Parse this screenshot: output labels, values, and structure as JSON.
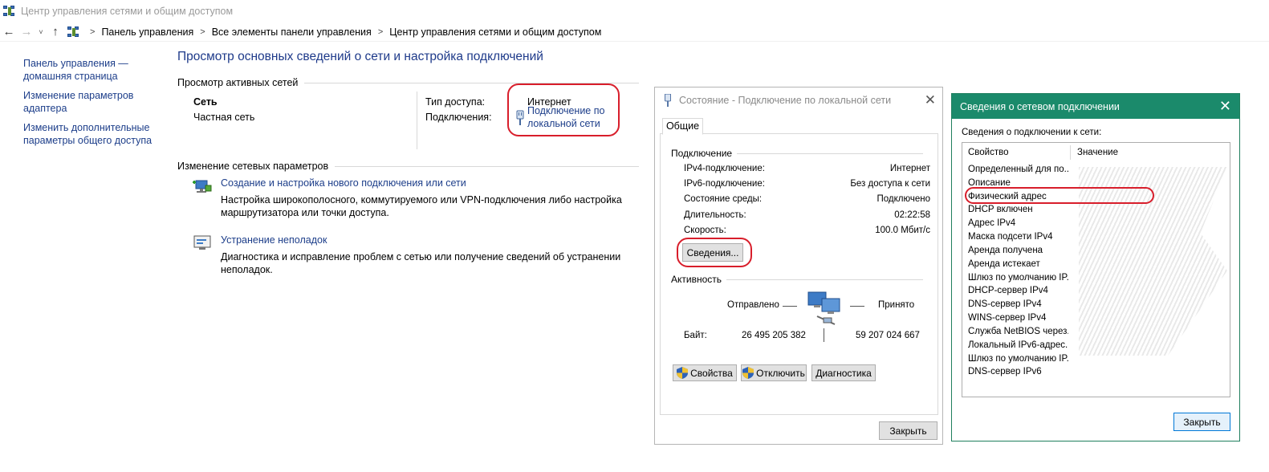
{
  "window": {
    "title": "Центр управления сетями и общим доступом"
  },
  "address_bar": {
    "breadcrumbs": [
      "Панель управления",
      "Все элементы панели управления",
      "Центр управления сетями и общим доступом"
    ]
  },
  "left_nav": {
    "items": [
      "Панель управления — домашняя страница",
      "Изменение параметров адаптера",
      "Изменить дополнительные параметры общего доступа"
    ]
  },
  "main": {
    "title": "Просмотр основных сведений о сети и настройка подключений",
    "active_networks_header": "Просмотр активных сетей",
    "network": {
      "name": "Сеть",
      "type": "Частная сеть",
      "access_type_label": "Тип доступа:",
      "access_type_value": "Интернет",
      "connections_label": "Подключения:",
      "connection_link_line1": "Подключение по",
      "connection_link_line2": "локальной сети"
    },
    "change_settings_header": "Изменение сетевых параметров",
    "tasks": [
      {
        "link": "Создание и настройка нового подключения или сети",
        "desc_line1": "Настройка широкополосного, коммутируемого или VPN-подключения либо настройка",
        "desc_line2": "маршрутизатора или точки доступа."
      },
      {
        "link": "Устранение неполадок",
        "desc_line1": "Диагностика и исправление проблем с сетью или получение сведений об устранении",
        "desc_line2": "неполадок."
      }
    ]
  },
  "status_dialog": {
    "title": "Состояние - Подключение по локальной сети",
    "tab": "Общие",
    "connection_header": "Подключение",
    "rows": [
      {
        "label": "IPv4-подключение:",
        "value": "Интернет"
      },
      {
        "label": "IPv6-подключение:",
        "value": "Без доступа к сети"
      },
      {
        "label": "Состояние среды:",
        "value": "Подключено"
      },
      {
        "label": "Длительность:",
        "value": "02:22:58"
      },
      {
        "label": "Скорость:",
        "value": "100.0 Мбит/с"
      }
    ],
    "details_button": "Сведения...",
    "activity_header": "Активность",
    "sent_label": "Отправлено",
    "received_label": "Принято",
    "bytes_label": "Байт:",
    "bytes_sent": "26 495 205 382",
    "bytes_received": "59 207 024 667",
    "properties_button": "Свойства",
    "disable_button": "Отключить",
    "diagnose_button": "Диагностика",
    "close_button": "Закрыть"
  },
  "details_dialog": {
    "title": "Сведения о сетевом подключении",
    "subtitle": "Сведения о подключении к сети:",
    "col_property": "Свойство",
    "col_value": "Значение",
    "properties": [
      "Определенный для по...",
      "Описание",
      "Физический адрес",
      "DHCP включен",
      "Адрес IPv4",
      "Маска подсети IPv4",
      "Аренда получена",
      "Аренда истекает",
      "Шлюз по умолчанию IP...",
      "DHCP-сервер IPv4",
      "DNS-сервер IPv4",
      "WINS-сервер IPv4",
      "Служба NetBIOS через...",
      "Локальный IPv6-адрес...",
      "Шлюз по умолчанию IP...",
      "DNS-сервер IPv6"
    ],
    "close_button": "Закрыть"
  },
  "colors": {
    "link": "#1d3e8a",
    "title_blue": "#1e3a8a",
    "highlight_red": "#d81e2b",
    "details_titlebar": "#1b8a6b"
  }
}
